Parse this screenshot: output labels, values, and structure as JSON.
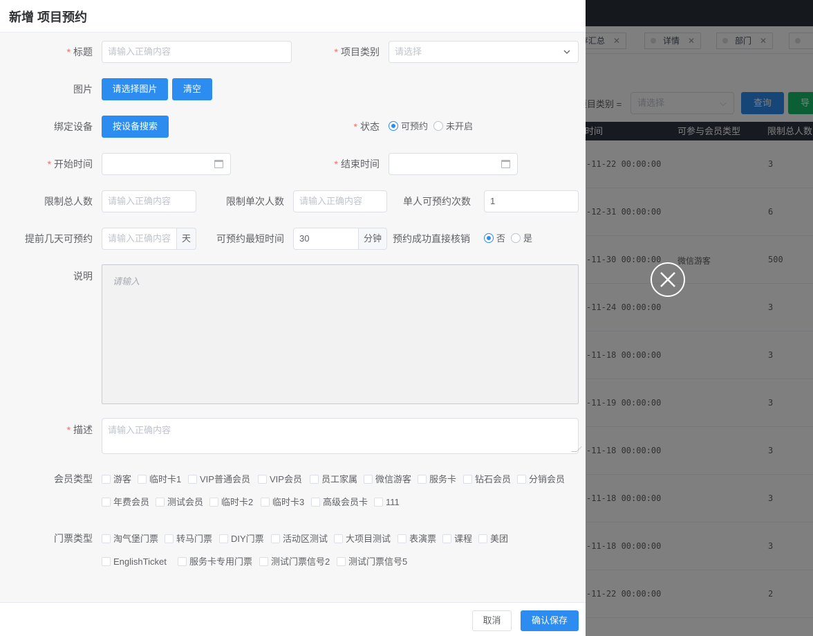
{
  "drawer": {
    "title": "新增 项目预约"
  },
  "form": {
    "title": {
      "label": "标题",
      "placeholder": "请输入正确内容"
    },
    "category": {
      "label": "项目类别",
      "placeholder": "请选择"
    },
    "image": {
      "label": "图片",
      "choose_button": "请选择图片",
      "clear_button": "清空"
    },
    "device": {
      "label": "绑定设备",
      "search_button": "按设备搜索"
    },
    "status": {
      "label": "状态",
      "options": [
        "可预约",
        "未开启"
      ],
      "selected": "可预约"
    },
    "start_time": {
      "label": "开始时间"
    },
    "end_time": {
      "label": "结束时间"
    },
    "limit_total": {
      "label": "限制总人数",
      "placeholder": "请输入正确内容"
    },
    "limit_single": {
      "label": "限制单次人数",
      "placeholder": "请输入正确内容"
    },
    "per_person_times": {
      "label": "单人可预约次数",
      "value": "1"
    },
    "advance_days": {
      "label": "提前几天可预约",
      "placeholder": "请输入正确内容",
      "suffix": "天"
    },
    "min_duration": {
      "label": "可预约最短时间",
      "value": "30",
      "suffix": "分钟"
    },
    "auto_verify": {
      "label": "预约成功直接核销",
      "options": [
        "否",
        "是"
      ],
      "selected": "否"
    },
    "explain": {
      "label": "说明",
      "placeholder": "请输入"
    },
    "description": {
      "label": "描述",
      "placeholder": "请输入正确内容"
    },
    "member_types": {
      "label": "会员类型",
      "row1": [
        "游客",
        "临时卡1",
        "VIP普通会员",
        "VIP会员",
        "员工家属",
        "微信游客",
        "服务卡",
        "钻石会员",
        "分销会员"
      ],
      "row2": [
        "年费会员",
        "测试会员",
        "临时卡2",
        "临时卡3",
        "高级会员卡",
        "111"
      ]
    },
    "ticket_types": {
      "label": "门票类型",
      "row1": [
        "淘气堡门票",
        "转马门票",
        "DIY门票",
        "活动区测试",
        "大项目测试",
        "表演票",
        "课程",
        "美团"
      ],
      "row2": [
        "EnglishTicket",
        "服务卡专用门票",
        "测试门票信号2",
        "测试门票信号5"
      ]
    }
  },
  "footer": {
    "cancel": "取消",
    "save": "确认保存"
  },
  "background": {
    "tags": [
      {
        "label": "存汇总"
      },
      {
        "label": "详情"
      },
      {
        "label": "部门"
      }
    ],
    "filter": {
      "label": "项目类别 =",
      "placeholder": "请选择",
      "query_button": "查询",
      "export_button": "导出"
    },
    "table": {
      "headers": [
        "时间",
        "可参与会员类型",
        "限制总人数"
      ],
      "rows": [
        {
          "time": "-11-22 00:00:00",
          "member": "",
          "limit": "3"
        },
        {
          "time": "-12-31 00:00:00",
          "member": "",
          "limit": "6"
        },
        {
          "time": "-11-30 00:00:00",
          "member": "微信游客",
          "limit": "500"
        },
        {
          "time": "-11-24 00:00:00",
          "member": "",
          "limit": "3"
        },
        {
          "time": "-11-18 00:00:00",
          "member": "",
          "limit": "3"
        },
        {
          "time": "-11-19 00:00:00",
          "member": "",
          "limit": "3"
        },
        {
          "time": "-11-18 00:00:00",
          "member": "",
          "limit": "3"
        },
        {
          "time": "-11-18 00:00:00",
          "member": "",
          "limit": "3"
        },
        {
          "time": "-11-18 00:00:00",
          "member": "",
          "limit": "3"
        },
        {
          "time": "-11-22 00:00:00",
          "member": "",
          "limit": "2"
        }
      ]
    }
  },
  "colors": {
    "primary": "#2d8cf0",
    "required": "#f56c6c",
    "export": "#19be6b"
  }
}
